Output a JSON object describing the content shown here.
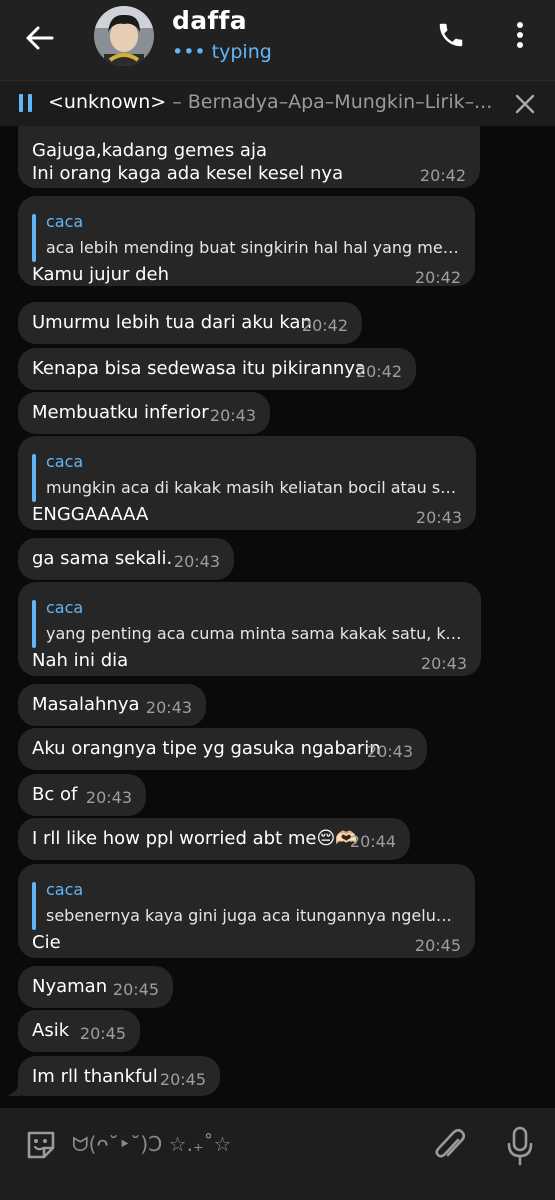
{
  "header": {
    "title": "daffa",
    "status_dots": "•••",
    "status": "typing"
  },
  "music": {
    "artist": "<unknown>",
    "track": " – Bernadya–Apa–Mungkin–Lirik–..."
  },
  "messages": {
    "m0": {
      "text1": "Gajuga,kadang gemes aja",
      "text2": "Ini orang kaga ada kesel kesel nya",
      "time": "20:42"
    },
    "m1": {
      "reply_name": "caca",
      "reply_text": "aca lebih mending buat singkirin hal hal yang menur…",
      "text": "Kamu jujur deh",
      "time": "20:42"
    },
    "m2": {
      "text": "Umurmu lebih tua dari aku kan",
      "time": "20:42"
    },
    "m3": {
      "text": "Kenapa bisa sedewasa itu pikirannya",
      "time": "20:42"
    },
    "m4": {
      "text": "Membuatku inferior",
      "time": "20:43"
    },
    "m5": {
      "reply_name": "caca",
      "reply_text": "mungkin aca di kakak masih keliatan bocil atau sem…",
      "text": "ENGGAAAAA",
      "time": "20:43"
    },
    "m6": {
      "text": "ga sama sekali.",
      "time": "20:43"
    },
    "m7": {
      "reply_name": "caca",
      "reply_text": "yang penting aca cuma minta sama kakak satu, kaba…",
      "text": "Nah ini dia",
      "time": "20:43"
    },
    "m8": {
      "text": "Masalahnya",
      "time": "20:43"
    },
    "m9": {
      "text": "Aku orangnya tipe yg gasuka ngabarin",
      "time": "20:43"
    },
    "m10": {
      "text": "Bc of",
      "time": "20:43"
    },
    "m11": {
      "text": "I rll like how ppl worried abt me😔🫶🏻",
      "time": "20:44"
    },
    "m12": {
      "reply_name": "caca",
      "reply_text": "sebenernya kaya gini juga aca itungannya ngelunjak…",
      "text": "Cie",
      "time": "20:45"
    },
    "m13": {
      "text": "Nyaman",
      "time": "20:45"
    },
    "m14": {
      "text": "Asik",
      "time": "20:45"
    },
    "m15": {
      "text": "Im rll thankful",
      "time": "20:45"
    }
  },
  "input": {
    "text": "ᗢ(ᴖ˘‣˘)Ↄ ☆.₊˚☆"
  },
  "colors": {
    "accent": "#64b5f6",
    "bubble": "#262626",
    "header": "#212121"
  },
  "icons": [
    "back-arrow-icon",
    "phone-icon",
    "more-vertical-icon",
    "pause-icon",
    "close-icon",
    "sticker-icon",
    "paperclip-icon",
    "microphone-icon"
  ]
}
